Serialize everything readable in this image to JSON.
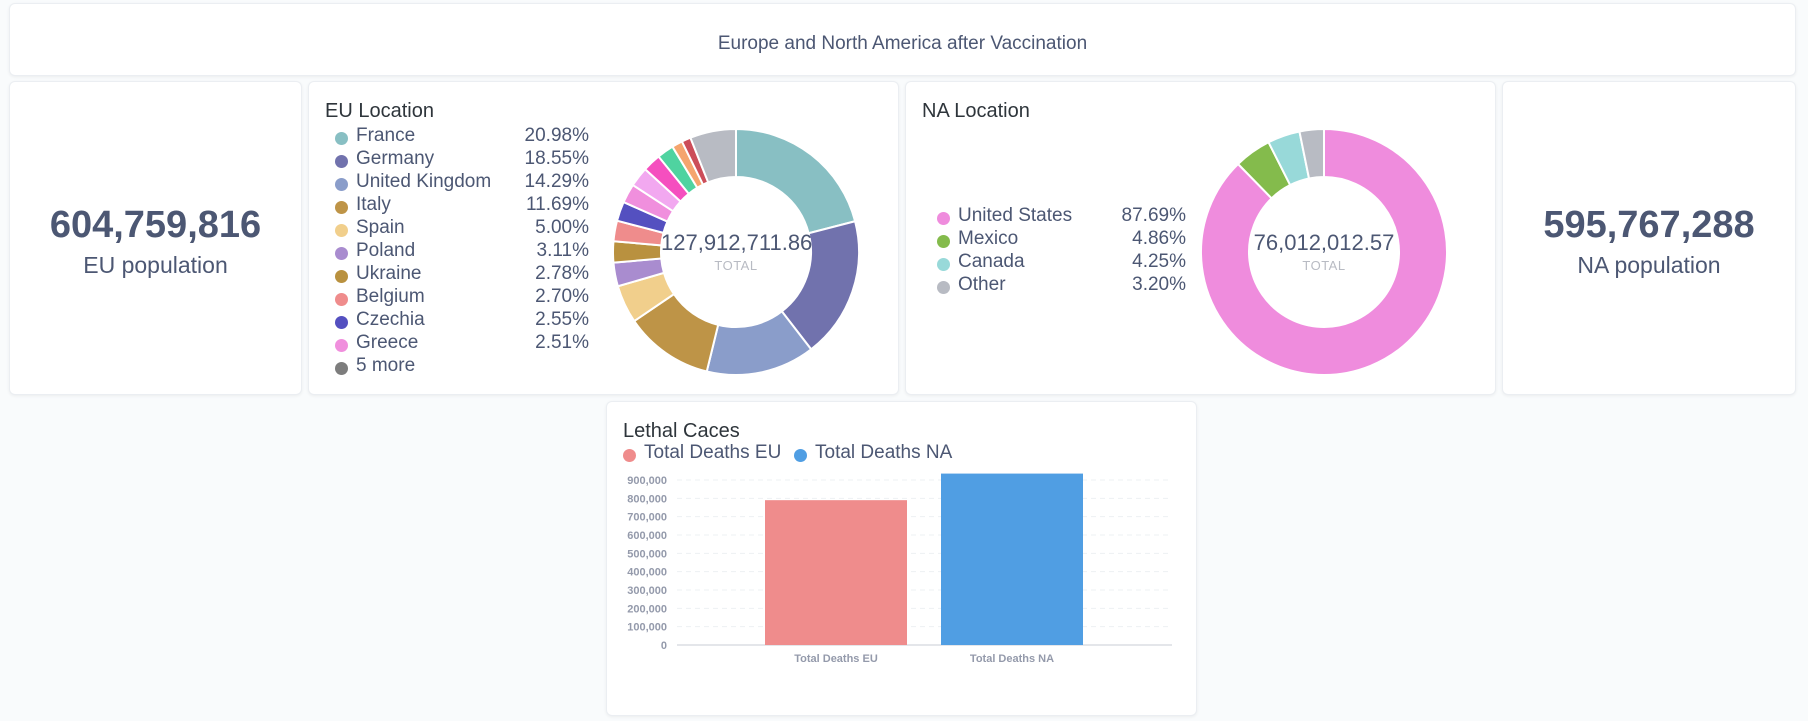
{
  "header": {
    "title": "Europe and North America after Vaccination"
  },
  "eu_scalar": {
    "value": "604,759,816",
    "label": "EU population"
  },
  "na_scalar": {
    "value": "595,767,288",
    "label": "NA population"
  },
  "eu_location": {
    "title": "EU Location",
    "total": "127,912,711.86",
    "total_label": "TOTAL",
    "legend": [
      {
        "name": "France",
        "pct": "20.98%",
        "color": "#88bfc3"
      },
      {
        "name": "Germany",
        "pct": "18.55%",
        "color": "#7172ad"
      },
      {
        "name": "United Kingdom",
        "pct": "14.29%",
        "color": "#8a9dca"
      },
      {
        "name": "Italy",
        "pct": "11.69%",
        "color": "#be9447"
      },
      {
        "name": "Spain",
        "pct": "5.00%",
        "color": "#f1cf8c"
      },
      {
        "name": "Poland",
        "pct": "3.11%",
        "color": "#a98ccf"
      },
      {
        "name": "Ukraine",
        "pct": "2.78%",
        "color": "#b9913f"
      },
      {
        "name": "Belgium",
        "pct": "2.70%",
        "color": "#ef8c8c"
      },
      {
        "name": "Czechia",
        "pct": "2.55%",
        "color": "#5450c0"
      },
      {
        "name": "Greece",
        "pct": "2.51%",
        "color": "#f08fdd"
      },
      {
        "name": "5 more",
        "pct": "",
        "color": "#7d7d7d"
      }
    ]
  },
  "na_location": {
    "title": "NA Location",
    "total": "76,012,012.57",
    "total_label": "TOTAL",
    "legend": [
      {
        "name": "United States",
        "pct": "87.69%",
        "color": "#ef8cdd"
      },
      {
        "name": "Mexico",
        "pct": "4.86%",
        "color": "#84bb4c"
      },
      {
        "name": "Canada",
        "pct": "4.25%",
        "color": "#98d9d9"
      },
      {
        "name": "Other",
        "pct": "3.20%",
        "color": "#b8bbc3"
      }
    ]
  },
  "chart_data": [
    {
      "type": "pie",
      "title": "EU Location",
      "total": 127912711.86,
      "categories": [
        "France",
        "Germany",
        "United Kingdom",
        "Italy",
        "Spain",
        "Poland",
        "Ukraine",
        "Belgium",
        "Czechia",
        "Greece",
        "5 more"
      ],
      "values": [
        20.98,
        18.55,
        14.29,
        11.69,
        5.0,
        3.11,
        2.78,
        2.7,
        2.55,
        2.51,
        15.84
      ],
      "unit": "percent",
      "extra_slice_colors": [
        "#f2a8f0",
        "#f54fbf",
        "#4fd3a0",
        "#f5a56e",
        "#cc4d59",
        "#b8bbc3"
      ],
      "extra_slice_values": [
        2.6,
        2.4,
        2.2,
        1.4,
        1.2,
        6.04
      ]
    },
    {
      "type": "pie",
      "title": "NA Location",
      "total": 76012012.57,
      "categories": [
        "United States",
        "Mexico",
        "Canada",
        "Other"
      ],
      "values": [
        87.69,
        4.86,
        4.25,
        3.2
      ],
      "unit": "percent"
    },
    {
      "type": "bar",
      "title": "Lethal Caces",
      "categories": [
        "Total Deaths EU",
        "Total Deaths NA"
      ],
      "series": [
        {
          "name": "Total Deaths EU",
          "values": [
            790000,
            null
          ],
          "color": "#ef8c8c"
        },
        {
          "name": "Total Deaths NA",
          "values": [
            null,
            935000
          ],
          "color": "#509ee3"
        }
      ],
      "ylim": [
        0,
        900000
      ],
      "yticks": [
        "0",
        "100,000",
        "200,000",
        "300,000",
        "400,000",
        "500,000",
        "600,000",
        "700,000",
        "800,000",
        "900,000"
      ],
      "grid": true,
      "legend_position": "top-left"
    }
  ]
}
